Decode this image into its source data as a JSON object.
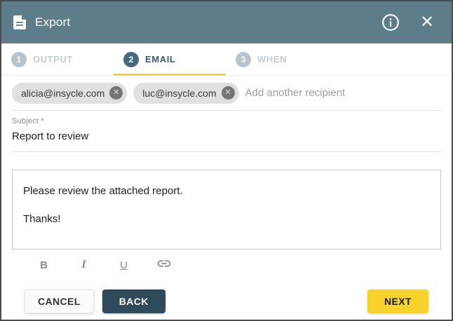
{
  "dialog": {
    "title": "Export",
    "header_bg": "#5d7d8b",
    "accent_color": "#f7d22e"
  },
  "steps": [
    {
      "number": "1",
      "label": "OUTPUT",
      "state": "inactive"
    },
    {
      "number": "2",
      "label": "EMAIL",
      "state": "active"
    },
    {
      "number": "3",
      "label": "WHEN",
      "state": "inactive"
    }
  ],
  "email": {
    "recipients": [
      "alicia@insycle.com",
      "luc@insycle.com"
    ],
    "remove_glyph": "✕",
    "add_recipient_placeholder": "Add another recipient",
    "subject_label": "Subject *",
    "subject_value": "Report to review",
    "body_lines": [
      "Please review the attached report.",
      "Thanks!"
    ]
  },
  "format_toolbar": {
    "bold_label": "B",
    "italic_label": "I",
    "underline_label": "U"
  },
  "footer": {
    "cancel_label": "CANCEL",
    "back_label": "BACK",
    "next_label": "NEXT"
  },
  "header_icons": {
    "close_glyph": "✕"
  }
}
